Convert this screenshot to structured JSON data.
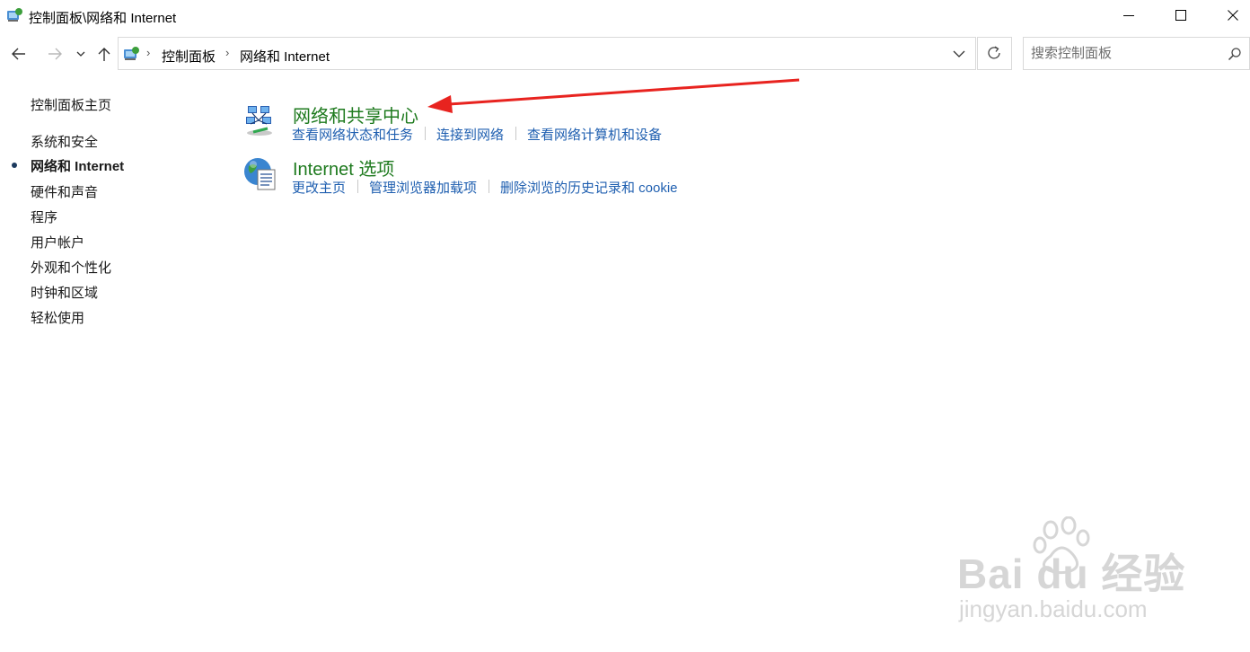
{
  "window": {
    "title": "控制面板\\网络和 Internet",
    "icon": "control-panel-icon",
    "controls": [
      "minimize-icon",
      "maximize-icon",
      "close-icon"
    ]
  },
  "nav": {
    "back": "arrow-left-icon",
    "forward": "arrow-right-icon",
    "recent": "chevron-down-icon",
    "up": "arrow-up-icon"
  },
  "address": {
    "breadcrumbs": [
      "控制面板",
      "网络和 Internet"
    ],
    "separator": "›"
  },
  "search": {
    "placeholder": "搜索控制面板",
    "value": ""
  },
  "sidebar": {
    "home": "控制面板主页",
    "items": [
      {
        "label": "系统和安全",
        "active": false
      },
      {
        "label": "网络和 Internet",
        "active": true
      },
      {
        "label": "硬件和声音",
        "active": false
      },
      {
        "label": "程序",
        "active": false
      },
      {
        "label": "用户帐户",
        "active": false
      },
      {
        "label": "外观和个性化",
        "active": false
      },
      {
        "label": "时钟和区域",
        "active": false
      },
      {
        "label": "轻松使用",
        "active": false
      }
    ]
  },
  "categories": [
    {
      "title": "网络和共享中心",
      "icon": "network-sharing-icon",
      "tasks": [
        "查看网络状态和任务",
        "连接到网络",
        "查看网络计算机和设备"
      ]
    },
    {
      "title": "Internet 选项",
      "icon": "internet-options-icon",
      "tasks": [
        "更改主页",
        "管理浏览器加载项",
        "删除浏览的历史记录和 cookie"
      ]
    }
  ],
  "watermark": {
    "logo": "Bai du 经验",
    "url": "jingyan.baidu.com"
  },
  "colors": {
    "category_title": "#1e7a1e",
    "task_link": "#1f5fb0",
    "annotation_arrow": "#e8231f",
    "border": "#d9d9d9"
  }
}
